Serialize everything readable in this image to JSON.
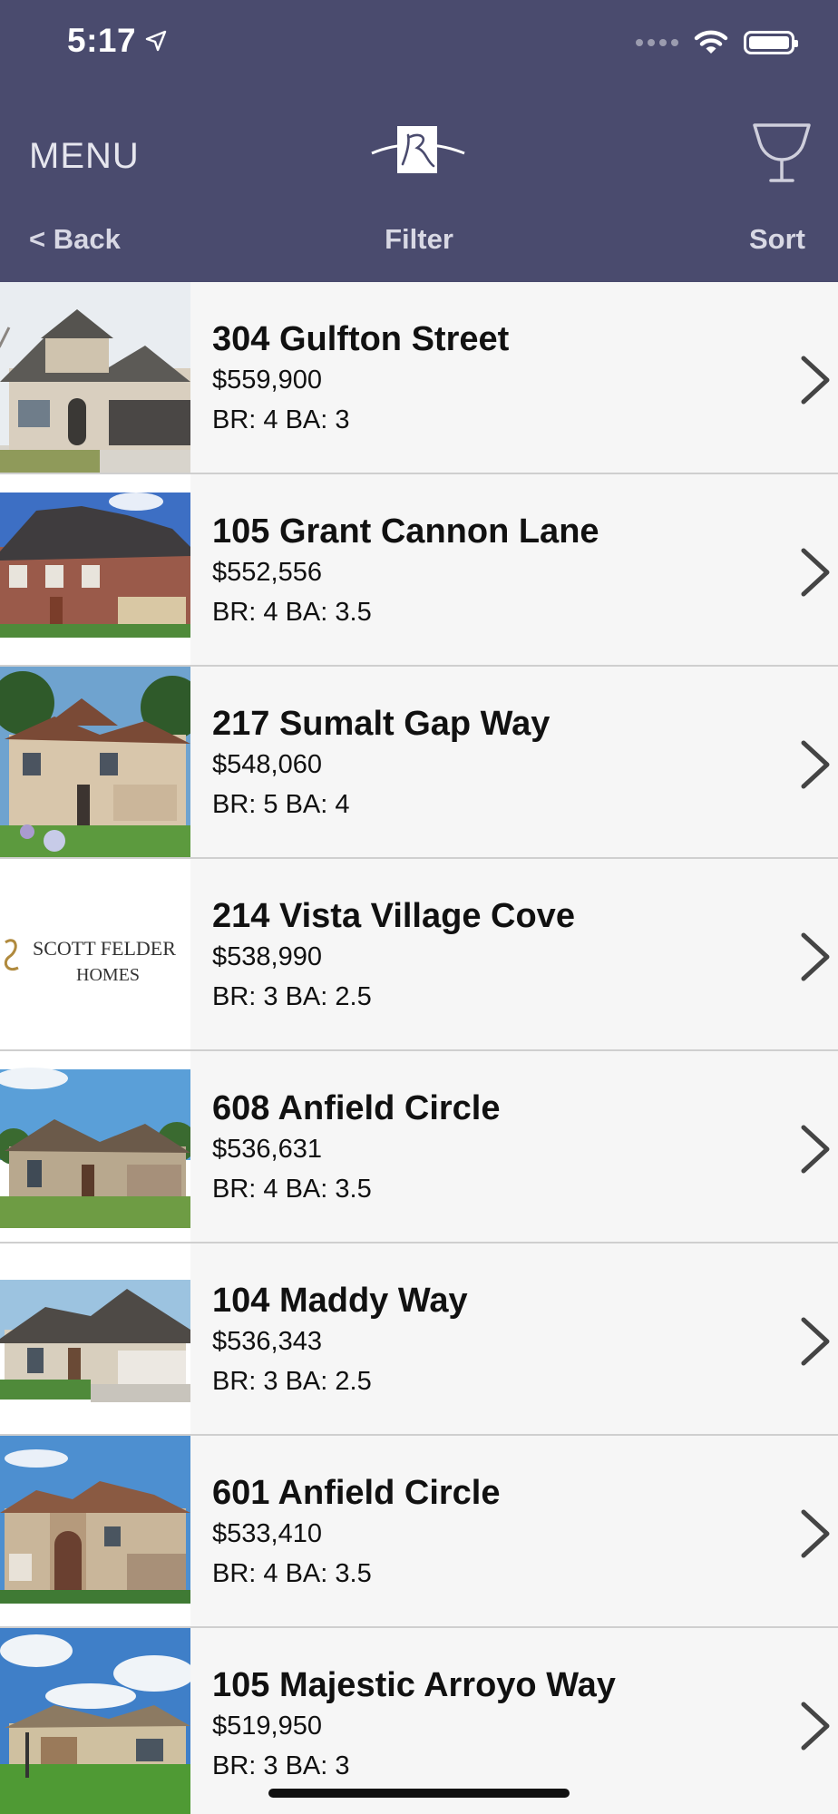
{
  "status_bar": {
    "time": "5:17"
  },
  "header": {
    "menu_label": "MENU",
    "logo": "builder-logo",
    "trophy": "trophy-icon",
    "back_label": "< Back",
    "filter_label": "Filter",
    "sort_label": "Sort"
  },
  "colors": {
    "header_bg": "#4a4b6e",
    "list_bg": "#f6f6f6"
  },
  "listings": [
    {
      "address": "304 Gulfton Street",
      "price": "$559,900",
      "rooms": "BR: 4 BA: 3",
      "thumb": "house-photo"
    },
    {
      "address": "105 Grant Cannon Lane",
      "price": "$552,556",
      "rooms": "BR: 4 BA: 3.5",
      "thumb": "house-photo"
    },
    {
      "address": "217 Sumalt Gap Way",
      "price": "$548,060",
      "rooms": "BR: 5 BA: 4",
      "thumb": "house-photo"
    },
    {
      "address": "214 Vista Village Cove",
      "price": "$538,990",
      "rooms": "BR: 3 BA: 2.5",
      "thumb": "builder-logo",
      "logo_text_1": "SCOTT FELDER",
      "logo_text_2": "HOMES"
    },
    {
      "address": "608 Anfield Circle",
      "price": "$536,631",
      "rooms": "BR: 4 BA: 3.5",
      "thumb": "house-photo"
    },
    {
      "address": "104 Maddy Way",
      "price": "$536,343",
      "rooms": "BR: 3 BA: 2.5",
      "thumb": "house-photo"
    },
    {
      "address": "601 Anfield Circle",
      "price": "$533,410",
      "rooms": "BR: 4 BA: 3.5",
      "thumb": "house-photo"
    },
    {
      "address": "105 Majestic Arroyo Way",
      "price": "$519,950",
      "rooms": "BR: 3 BA: 3",
      "thumb": "house-photo"
    }
  ]
}
